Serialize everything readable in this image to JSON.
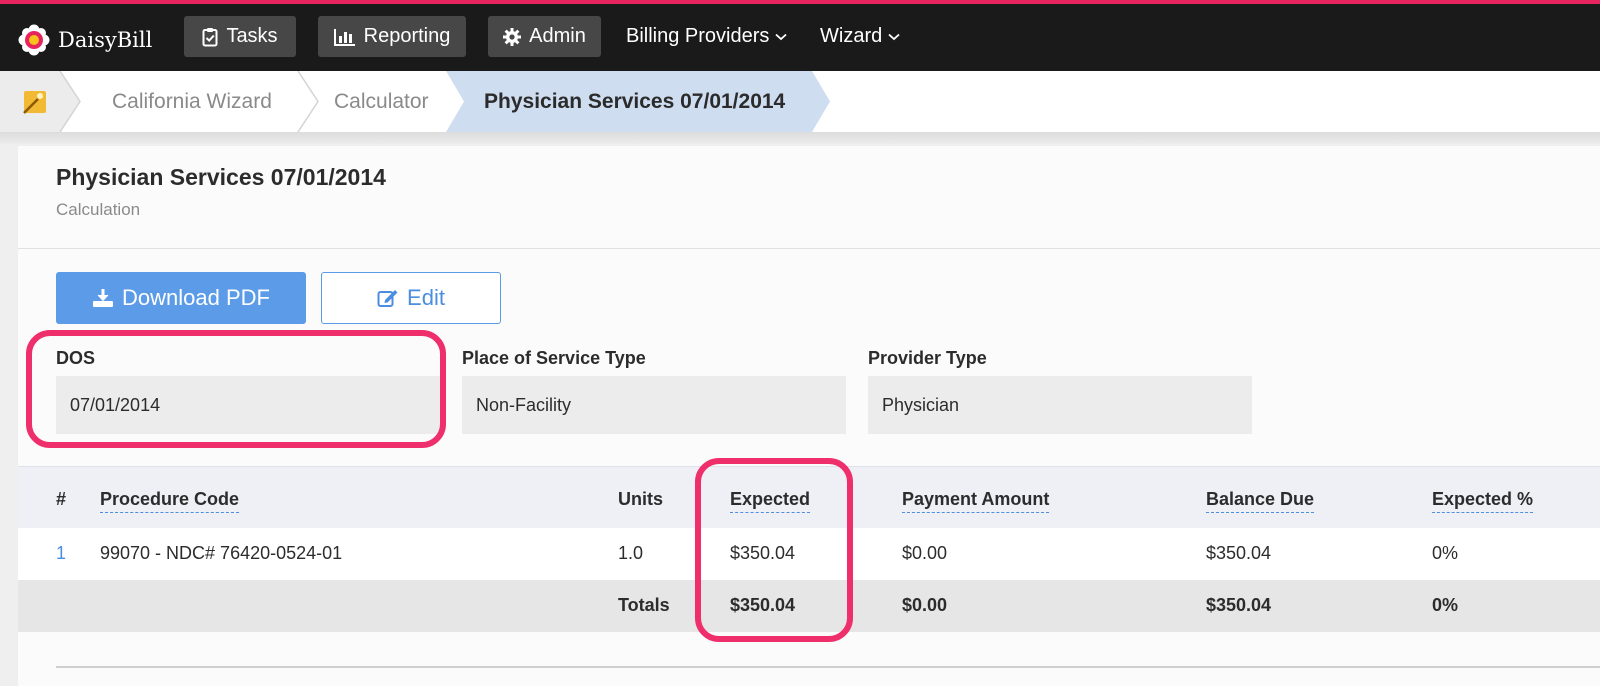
{
  "colors": {
    "accent_pink": "#e8245f",
    "nav_bg": "#1a1a1a",
    "primary_blue": "#5b9be8",
    "breadcrumb_active": "#cfddf0"
  },
  "nav": {
    "brand": "DaisyBill",
    "tasks": "Tasks",
    "reporting": "Reporting",
    "admin": "Admin",
    "billing_providers": "Billing Providers",
    "wizard": "Wizard"
  },
  "breadcrumb": {
    "items": [
      "California Wizard",
      "Calculator",
      "Physician Services 07/01/2014"
    ]
  },
  "page": {
    "title": "Physician Services 07/01/2014",
    "subtitle": "Calculation",
    "download_label": "Download PDF",
    "edit_label": "Edit"
  },
  "fields": {
    "dos_label": "DOS",
    "dos_value": "07/01/2014",
    "pos_label": "Place of Service Type",
    "pos_value": "Non-Facility",
    "provider_label": "Provider Type",
    "provider_value": "Physician"
  },
  "table": {
    "headers": [
      "#",
      "Procedure Code",
      "Units",
      "Expected",
      "Payment Amount",
      "Balance Due",
      "Expected %"
    ],
    "rows": [
      {
        "num": "1",
        "code": "99070 - NDC# 76420-0524-01",
        "units": "1.0",
        "expected": "$350.04",
        "payment": "$0.00",
        "balance": "$350.04",
        "pct": "0%"
      }
    ],
    "totals": {
      "label": "Totals",
      "expected": "$350.04",
      "payment": "$0.00",
      "balance": "$350.04",
      "pct": "0%"
    }
  }
}
